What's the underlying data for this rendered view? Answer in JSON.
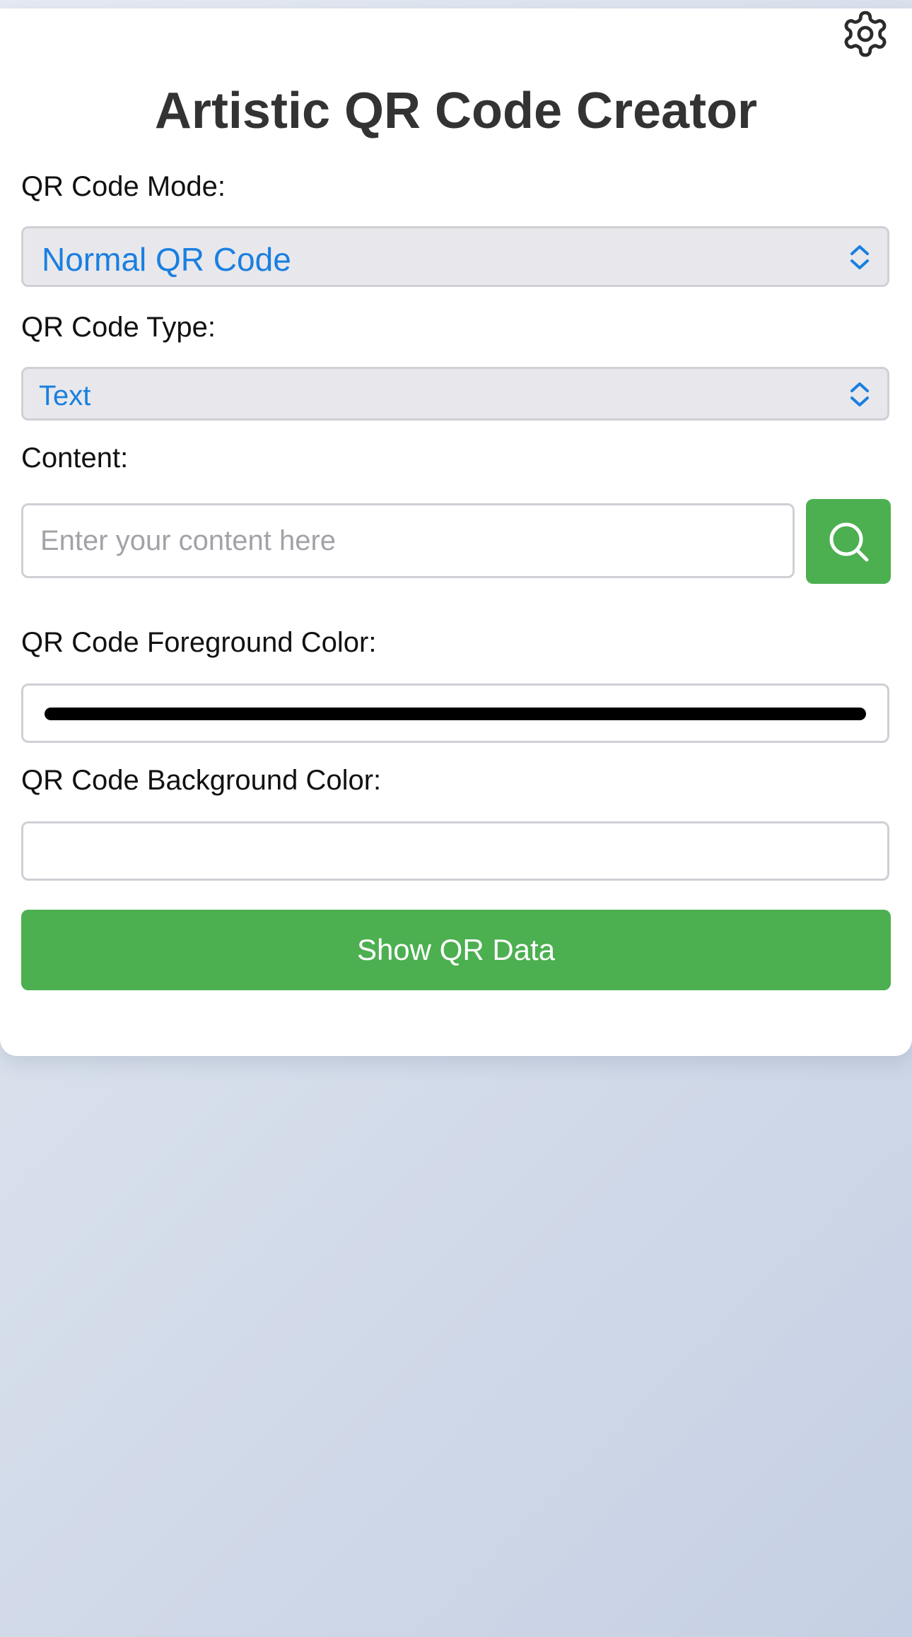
{
  "header": {
    "title": "Artistic QR Code Creator",
    "settings_icon": "gear-icon"
  },
  "form": {
    "mode": {
      "label": "QR Code Mode:",
      "value": "Normal QR Code"
    },
    "type": {
      "label": "QR Code Type:",
      "value": "Text"
    },
    "content": {
      "label": "Content:",
      "placeholder": "Enter your content here",
      "value": "",
      "search_icon": "search-icon"
    },
    "foreground": {
      "label": "QR Code Foreground Color:",
      "value": "#000000"
    },
    "background": {
      "label": "QR Code Background Color:",
      "value": "#ffffff"
    },
    "submit_label": "Show QR Data"
  },
  "colors": {
    "accent_green": "#4caf50",
    "select_text_blue": "#1a7fe0",
    "title_text": "#333333"
  }
}
